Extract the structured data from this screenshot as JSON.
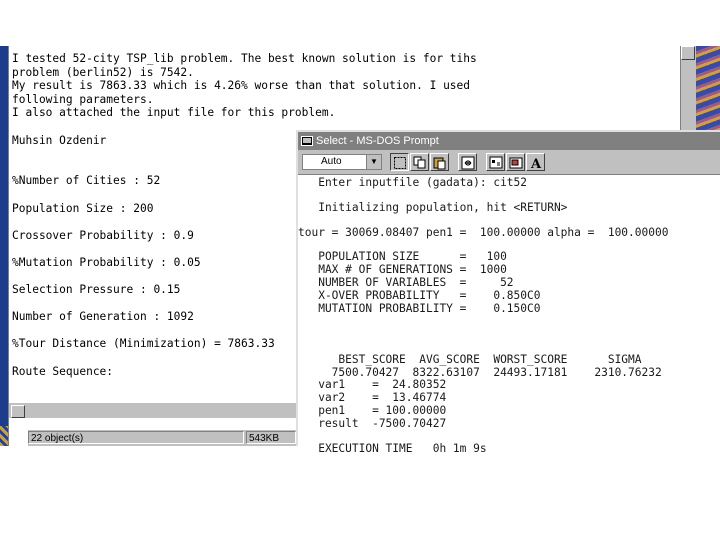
{
  "notepad": {
    "lines": [
      "I tested 52-city TSP_lib problem. The best known solution is for tihs",
      "problem (berlin52) is 7542.",
      "My result is 7863.33 which is 4.26% worse than that solution. I used",
      "following parameters.",
      "I also attached the input file for this problem.",
      "",
      "Muhsin Ozdenir",
      "",
      "",
      "%Number of Cities : 52",
      "",
      "Population Size : 200",
      "",
      "Crossover Probability : 0.9",
      "",
      "%Mutation Probability : 0.05",
      "",
      "Selection Pressure : 0.15",
      "",
      "Number of Generation : 1092",
      "",
      "%Tour Distance (Minimization) = 7863.33",
      "",
      "Route Sequence:"
    ]
  },
  "status": {
    "objects": "22 object(s)",
    "size": "543KB"
  },
  "dos": {
    "title": "Select - MS-DOS Prompt",
    "font_select": "Auto",
    "lines": [
      "   Enter inputfile (gadata): cit52",
      "",
      "   Initializing population, hit <RETURN>",
      "",
      "tour = 30069.08407 pen1 =  100.00000 alpha =  100.00000",
      "",
      "   POPULATION SIZE      =   100",
      "   MAX # OF GENERATIONS =  1000",
      "   NUMBER OF VARIABLES  =     52",
      "   X-OVER PROBABILITY   =    0.850C0",
      "   MUTATION PROBABILITY =    0.150C0",
      "",
      "",
      "",
      "      BEST_SCORE  AVG_SCORE  WORST_SCORE      SIGMA",
      "     7500.70427  8322.63107  24493.17181    2310.76232",
      "   var1    =  24.80352",
      "   var2    =  13.46774",
      "   pen1    = 100.00000",
      "   result  -7500.70427",
      "",
      "   EXECUTION TIME   0h 1m 9s"
    ]
  },
  "colors": {
    "titlebar_inactive": "#808080",
    "window_face": "#c0c0c0",
    "desktop": "#1e3c8c"
  }
}
